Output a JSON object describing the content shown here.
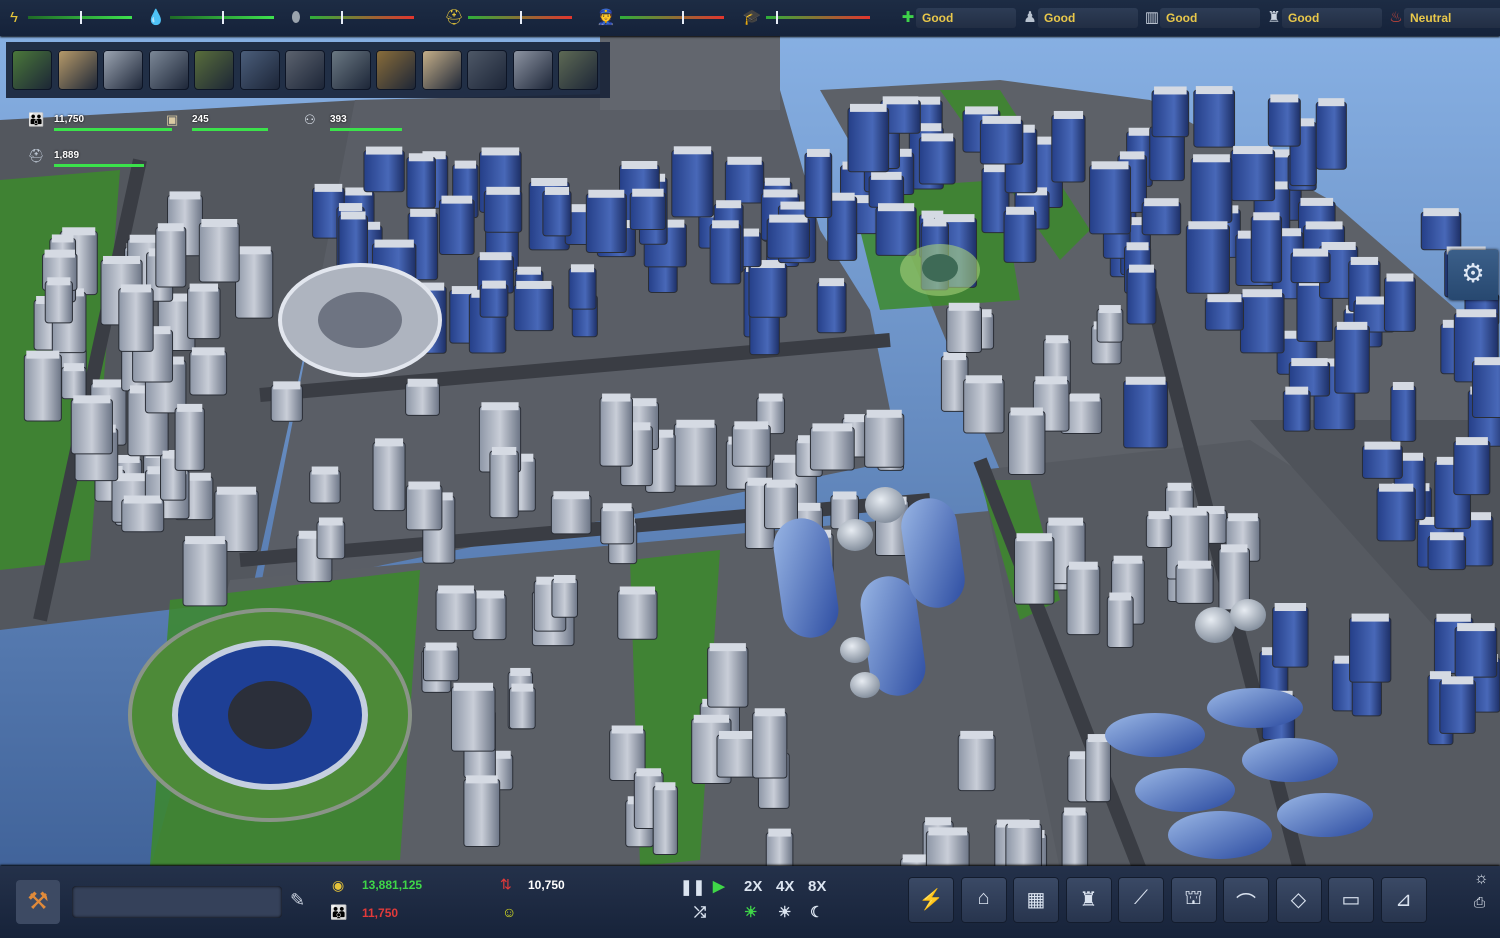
{
  "top_hud": {
    "resources": [
      {
        "icon": "lightning-icon",
        "glyph": "ϟ",
        "color": "#e6c63a",
        "level": 0.5,
        "bar": "green"
      },
      {
        "icon": "water-drop-icon",
        "glyph": "💧",
        "color": "#4aa6e8",
        "level": 0.5,
        "bar": "green"
      },
      {
        "icon": "oil-drop-icon",
        "glyph": "⬮",
        "color": "#9aa3ad",
        "level": 0.3,
        "bar": "red"
      },
      {
        "icon": "worker-helmet-icon",
        "glyph": "⛑",
        "color": "#e6c63a",
        "level": 0.5,
        "bar": "red"
      },
      {
        "icon": "police-icon",
        "glyph": "👮",
        "color": "#b5c4d6",
        "level": 0.6,
        "bar": "red"
      },
      {
        "icon": "graduate-icon",
        "glyph": "🎓",
        "color": "#c5ccd6",
        "level": 0.1,
        "bar": "red"
      }
    ],
    "status": [
      {
        "icon": "health-cross-icon",
        "glyph": "✚",
        "color": "#3ed24a",
        "label": "Good"
      },
      {
        "icon": "people-icon",
        "glyph": "♟",
        "color": "#b8c2cf",
        "label": "Good"
      },
      {
        "icon": "map-icon",
        "glyph": "▥",
        "color": "#c9d2de",
        "label": "Good"
      },
      {
        "icon": "city-icon",
        "glyph": "♜",
        "color": "#c9d2de",
        "label": "Good"
      },
      {
        "icon": "fire-hydrant-icon",
        "glyph": "♨",
        "color": "#e04a3a",
        "label": "Neutral"
      }
    ]
  },
  "toolbar": [
    {
      "name": "terrain-tool-icon"
    },
    {
      "name": "zoning-tool-icon"
    },
    {
      "name": "residential-tool-icon"
    },
    {
      "name": "road-tool-icon"
    },
    {
      "name": "services-tool-icon"
    },
    {
      "name": "science-tool-icon"
    },
    {
      "name": "industry-tool-icon"
    },
    {
      "name": "transport-tool-icon"
    },
    {
      "name": "statistics-tool-icon"
    },
    {
      "name": "policy-tool-icon"
    },
    {
      "name": "power-tool-icon"
    },
    {
      "name": "landmark-tool-icon"
    },
    {
      "name": "budget-tool-icon"
    }
  ],
  "population": {
    "residents": "11,750",
    "workers": "245",
    "students": "393",
    "unemployed": "1,889"
  },
  "bottom": {
    "money": "13,881,125",
    "population": "11,750",
    "housing": "10,750",
    "speeds": [
      "2X",
      "4X",
      "8X"
    ],
    "buildings": [
      {
        "name": "power-plant-building-icon",
        "glyph": "⚡"
      },
      {
        "name": "residential-building-icon",
        "glyph": "⌂"
      },
      {
        "name": "office-building-icon",
        "glyph": "▦"
      },
      {
        "name": "industrial-building-icon",
        "glyph": "♜"
      },
      {
        "name": "road-building-icon",
        "glyph": "⟋"
      },
      {
        "name": "capitol-building-icon",
        "glyph": "⛫"
      },
      {
        "name": "park-building-icon",
        "glyph": "⌒"
      },
      {
        "name": "landmark-building-icon",
        "glyph": "◇"
      },
      {
        "name": "warehouse-building-icon",
        "glyph": "▭"
      },
      {
        "name": "crane-building-icon",
        "glyph": "⊿"
      }
    ]
  }
}
